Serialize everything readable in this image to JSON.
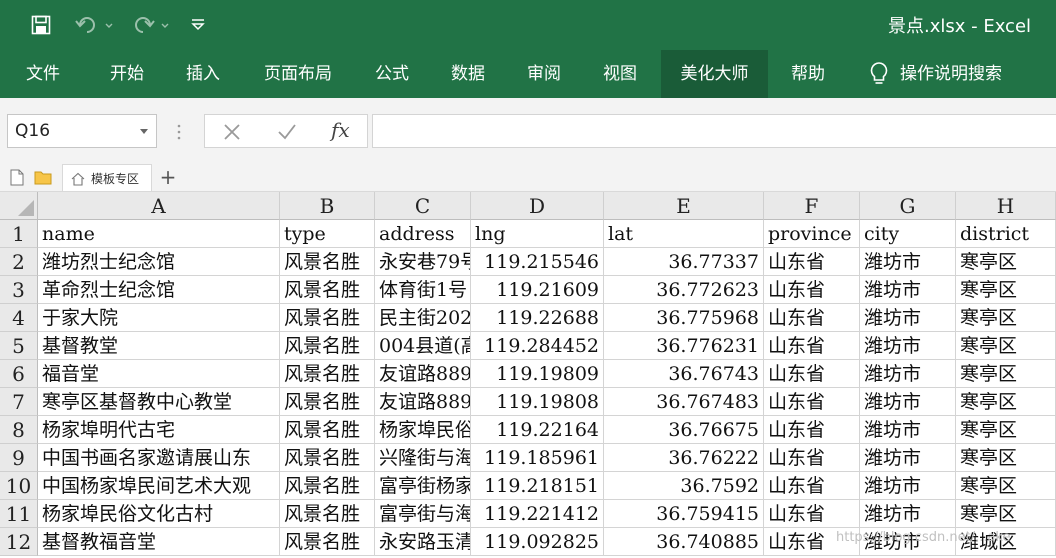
{
  "window": {
    "title": "景点.xlsx  -  Excel"
  },
  "qat": {
    "save": "save-icon",
    "undo": "undo-icon",
    "redo": "redo-icon",
    "customize": "customize-qat-icon"
  },
  "ribbon": {
    "tabs": [
      {
        "label": "文件",
        "active": false
      },
      {
        "label": "开始",
        "active": false
      },
      {
        "label": "插入",
        "active": false
      },
      {
        "label": "页面布局",
        "active": false
      },
      {
        "label": "公式",
        "active": false
      },
      {
        "label": "数据",
        "active": false
      },
      {
        "label": "审阅",
        "active": false
      },
      {
        "label": "视图",
        "active": false
      },
      {
        "label": "美化大师",
        "active": true
      },
      {
        "label": "帮助",
        "active": false
      }
    ],
    "tell_me": "操作说明搜索"
  },
  "formula_bar": {
    "name_box": "Q16",
    "fx": "fx",
    "value": ""
  },
  "sheet_tabs": {
    "template_label": "模板专区",
    "add": "+"
  },
  "grid": {
    "columns": [
      "A",
      "B",
      "C",
      "D",
      "E",
      "F",
      "G",
      "H"
    ],
    "rows": [
      {
        "n": "1",
        "cells": [
          "name",
          "type",
          "address",
          "lng",
          "lat",
          "province",
          "city",
          "district"
        ]
      },
      {
        "n": "2",
        "cells": [
          "潍坊烈士纪念馆",
          "风景名胜",
          "永安巷79号",
          "119.215546",
          "36.77337",
          "山东省",
          "潍坊市",
          "寒亭区"
        ]
      },
      {
        "n": "3",
        "cells": [
          "革命烈士纪念馆",
          "风景名胜",
          "体育街1号",
          "119.21609",
          "36.772623",
          "山东省",
          "潍坊市",
          "寒亭区"
        ]
      },
      {
        "n": "4",
        "cells": [
          "于家大院",
          "风景名胜",
          "民主街202",
          "119.22688",
          "36.775968",
          "山东省",
          "潍坊市",
          "寒亭区"
        ]
      },
      {
        "n": "5",
        "cells": [
          "基督教堂",
          "风景名胜",
          "004县道(高",
          "119.284452",
          "36.776231",
          "山东省",
          "潍坊市",
          "寒亭区"
        ]
      },
      {
        "n": "6",
        "cells": [
          "福音堂",
          "风景名胜",
          "友谊路889",
          "119.19809",
          "36.76743",
          "山东省",
          "潍坊市",
          "寒亭区"
        ]
      },
      {
        "n": "7",
        "cells": [
          "寒亭区基督教中心教堂",
          "风景名胜",
          "友谊路889",
          "119.19808",
          "36.767483",
          "山东省",
          "潍坊市",
          "寒亭区"
        ]
      },
      {
        "n": "8",
        "cells": [
          "杨家埠明代古宅",
          "风景名胜",
          "杨家埠民俗",
          "119.22164",
          "36.76675",
          "山东省",
          "潍坊市",
          "寒亭区"
        ]
      },
      {
        "n": "9",
        "cells": [
          "中国书画名家邀请展山东",
          "风景名胜",
          "兴隆街与海",
          "119.185961",
          "36.76222",
          "山东省",
          "潍坊市",
          "寒亭区"
        ]
      },
      {
        "n": "10",
        "cells": [
          "中国杨家埠民间艺术大观",
          "风景名胜",
          "富亭街杨家",
          "119.218151",
          "36.7592",
          "山东省",
          "潍坊市",
          "寒亭区"
        ]
      },
      {
        "n": "11",
        "cells": [
          "杨家埠民俗文化古村",
          "风景名胜",
          "富亭街与海",
          "119.221412",
          "36.759415",
          "山东省",
          "潍坊市",
          "寒亭区"
        ]
      },
      {
        "n": "12",
        "cells": [
          "基督教福音堂",
          "风景名胜",
          "永安路玉清",
          "119.092825",
          "36.740885",
          "山东省",
          "潍坊市",
          "潍城区"
        ]
      }
    ]
  },
  "watermark": "https://blog.csdn.net/...ake"
}
